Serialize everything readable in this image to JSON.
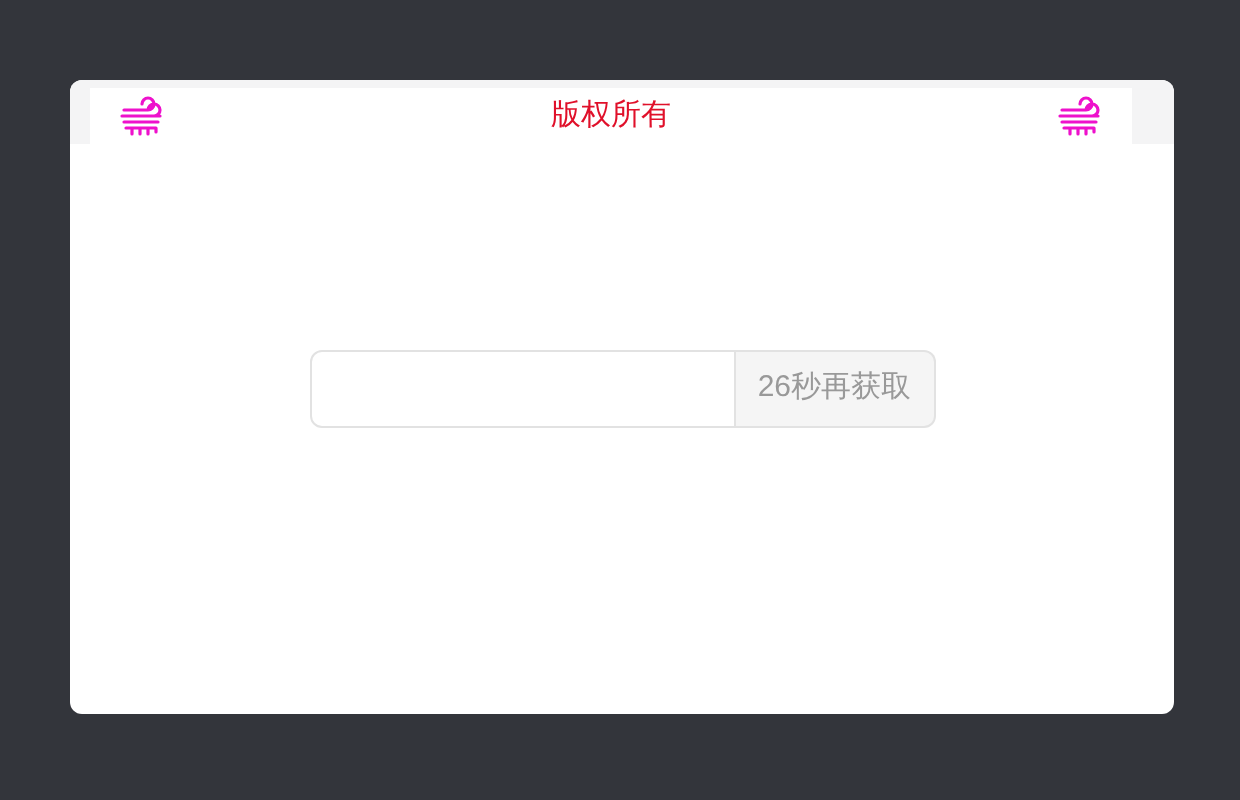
{
  "header": {
    "title": "版权所有"
  },
  "form": {
    "button": {
      "label": "26秒再获取",
      "disabled": true
    }
  }
}
